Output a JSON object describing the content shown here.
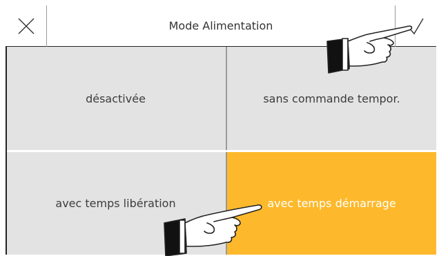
{
  "header": {
    "title": "Mode Alimentation",
    "close_icon": "close-icon",
    "confirm_icon": "checkmark-icon"
  },
  "options": [
    {
      "label": "désactivée",
      "selected": false
    },
    {
      "label": "sans commande tempor.",
      "selected": false
    },
    {
      "label": "avec temps libération",
      "selected": false
    },
    {
      "label": "avec temps démarrage",
      "selected": true
    }
  ],
  "colors": {
    "tile_background": "#e3e3e4",
    "selected_background": "#fdb92b",
    "selected_text": "#ffffff"
  },
  "annotations": {
    "pointer_icon": "pointing-hand-icon"
  }
}
